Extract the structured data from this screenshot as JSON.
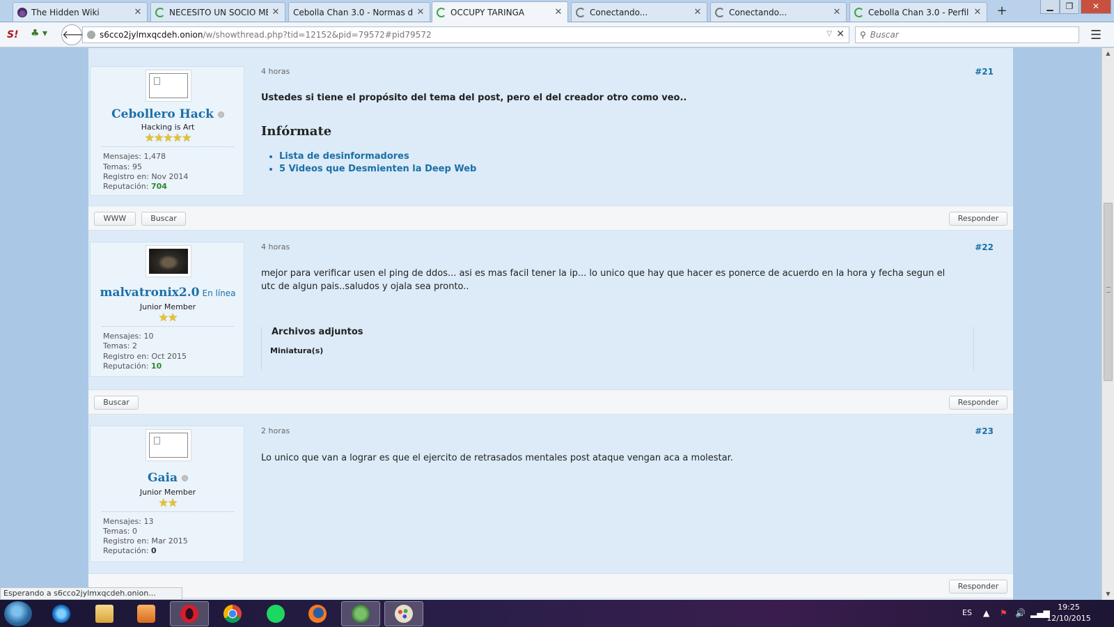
{
  "tabs": [
    {
      "title": "The Hidden Wiki"
    },
    {
      "title": "NECESITO UN SOCIO ME..."
    },
    {
      "title": "Cebolla Chan 3.0 - Normas d..."
    },
    {
      "title": "OCCUPY TARINGA"
    },
    {
      "title": "Conectando..."
    },
    {
      "title": "Conectando..."
    },
    {
      "title": "Cebolla Chan 3.0 - Perfil ..."
    }
  ],
  "navbar": {
    "logo_text": "S!",
    "url_host": "s6cco2jylmxqcdeh.onion",
    "url_path": "/w/showthread.php?tid=12152&pid=79572#pid79572",
    "search_placeholder": "Buscar"
  },
  "posts": [
    {
      "username": "Cebollero Hack",
      "online_text": "",
      "usertitle": "Hacking is Art",
      "stars": "★★★★★",
      "stats": {
        "mensajes": "Mensajes: 1,478",
        "temas": "Temas: 95",
        "registro": "Registro en: Nov 2014",
        "reputacion_label": "Reputación:",
        "reputacion_value": "704"
      },
      "time": "4 horas",
      "number": "#21",
      "text": "Ustedes si tiene el propósito del tema del post, pero el del creador otro como veo..",
      "heading": "Infórmate",
      "links": [
        "Lista de desinformadores",
        "5 Videos que Desmienten la Deep Web"
      ],
      "controls": {
        "www": "WWW",
        "buscar": "Buscar",
        "responder": "Responder"
      }
    },
    {
      "username": "malvatronix2.0",
      "online_text": "En línea",
      "usertitle": "Junior Member",
      "stars": "★★",
      "stats": {
        "mensajes": "Mensajes: 10",
        "temas": "Temas: 2",
        "registro": "Registro en: Oct 2015",
        "reputacion_label": "Reputación:",
        "reputacion_value": "10"
      },
      "time": "4 horas",
      "number": "#22",
      "text": "mejor para verificar usen el ping de ddos... asi es mas facil tener la ip... lo unico que hay que hacer es ponerce de acuerdo en la hora y fecha segun el utc de algun pais..saludos y ojala sea pronto..",
      "attachments_title": "Archivos adjuntos",
      "attachments_sub": "Miniatura(s)",
      "controls": {
        "buscar": "Buscar",
        "responder": "Responder"
      }
    },
    {
      "username": "Gaia",
      "online_text": "",
      "usertitle": "Junior Member",
      "stars": "★★",
      "stats": {
        "mensajes": "Mensajes: 13",
        "temas": "Temas: 0",
        "registro": "Registro en: Mar 2015",
        "reputacion_label": "Reputación:",
        "reputacion_value": "0"
      },
      "time": "2 horas",
      "number": "#23",
      "text": "Lo unico que van a lograr es que el ejercito de retrasados mentales post ataque vengan aca a molestar.",
      "controls": {
        "responder": "Responder"
      }
    }
  ],
  "statusbar": {
    "text": "Esperando a s6cco2jylmxqcdeh.onion..."
  },
  "taskbar": {
    "apps": [
      "internet-explorer",
      "file-explorer",
      "media-player",
      "opera",
      "chrome",
      "spotify",
      "firefox",
      "tor-globe",
      "paint"
    ],
    "lang": "ES",
    "time": "19:25",
    "date": "12/10/2015"
  },
  "colors": {
    "link": "#1b6fa8",
    "reputation": "#2b8a2b",
    "post_bg": "#dcebf7",
    "author_bg": "#ebf3fb"
  }
}
